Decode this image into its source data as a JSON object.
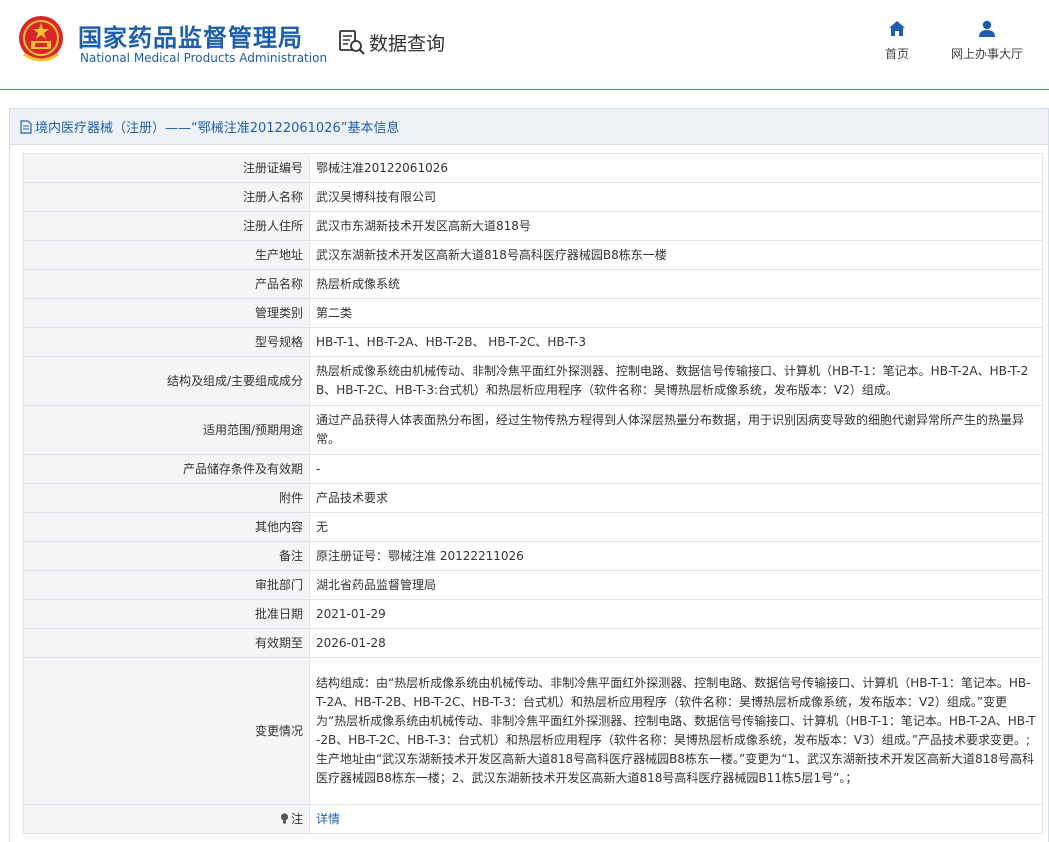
{
  "header": {
    "agency_cn": "国家药品监督管理局",
    "agency_en": "National Medical Products Administration",
    "query_label": "数据查询",
    "nav": [
      {
        "label": "首页",
        "icon": "home-icon"
      },
      {
        "label": "网上办事大厅",
        "icon": "user-icon"
      }
    ]
  },
  "panel": {
    "title": "境内医疗器械（注册）——“鄂械注准20122061026”基本信息"
  },
  "rows": [
    {
      "label": "注册证编号",
      "value": "鄂械注准20122061026"
    },
    {
      "label": "注册人名称",
      "value": "武汉昊博科技有限公司"
    },
    {
      "label": "注册人住所",
      "value": "武汉市东湖新技术开发区高新大道818号"
    },
    {
      "label": "生产地址",
      "value": "武汉东湖新技术开发区高新大道818号高科医疗器械园B8栋东一楼"
    },
    {
      "label": "产品名称",
      "value": "热层析成像系统"
    },
    {
      "label": "管理类别",
      "value": "第二类"
    },
    {
      "label": "型号规格",
      "value": "HB-T-1、HB-T-2A、HB-T-2B、 HB-T-2C、HB-T-3"
    },
    {
      "label": "结构及组成/主要组成成分",
      "value": "热层析成像系统由机械传动、非制冷焦平面红外探测器、控制电路、数据信号传输接口、计算机（HB-T-1：笔记本。HB-T-2A、HB-T-2B、HB-T-2C、HB-T-3:台式机）和热层析应用程序（软件名称：昊博热层析成像系统，发布版本：V2）组成。"
    },
    {
      "label": "适用范围/预期用途",
      "value": "通过产品获得人体表面热分布图，经过生物传热方程得到人体深层热量分布数据，用于识别因病变导致的细胞代谢异常所产生的热量异常。"
    },
    {
      "label": "产品储存条件及有效期",
      "value": "-"
    },
    {
      "label": "附件",
      "value": "产品技术要求"
    },
    {
      "label": "其他内容",
      "value": "无"
    },
    {
      "label": "备注",
      "value": "原注册证号：鄂械注准 20122211026"
    },
    {
      "label": "审批部门",
      "value": "湖北省药品监督管理局"
    },
    {
      "label": "批准日期",
      "value": "2021-01-29"
    },
    {
      "label": "有效期至",
      "value": "2026-01-28"
    },
    {
      "label": "变更情况",
      "value": "结构组成：由“热层析成像系统由机械传动、非制冷焦平面红外探测器、控制电路、数据信号传输接口、计算机（HB-T-1：笔记本。HB-T-2A、HB-T-2B、HB-T-2C、HB-T-3：台式机）和热层析应用程序（软件名称：昊博热层析成像系统，发布版本：V2）组成。”变更为“热层析成像系统由机械传动、非制冷焦平面红外探测器、控制电路、数据信号传输接口、计算机（HB-T-1：笔记本。HB-T-2A、HB-T-2B、HB-T-2C、HB-T-3：台式机）和热层析应用程序（软件名称：昊博热层析成像系统，发布版本：V3）组成。”产品技术要求变更。;生产地址由“武汉东湖新技术开发区高新大道818号高科医疗器械园B8栋东一楼。”变更为“1、武汉东湖新技术开发区高新大道818号高科医疗器械园B8栋东一楼；2、武汉东湖新技术开发区高新大道818号高科医疗器械园B11栋5层1号”。；"
    },
    {
      "label": "注",
      "value": "详情",
      "icon": "lightbulb-icon"
    }
  ],
  "colors": {
    "brand": "#1d5fae",
    "label_bg": "#f4f5f7",
    "border": "#e1e5ea"
  }
}
